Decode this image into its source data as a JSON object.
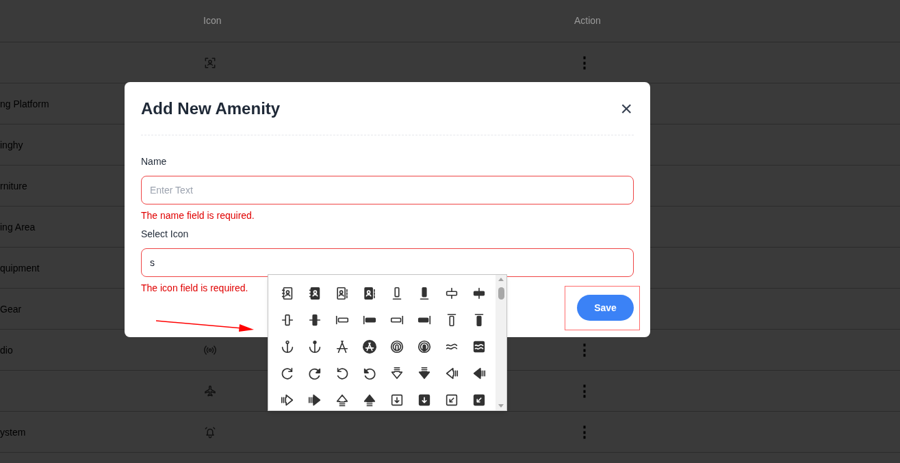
{
  "table": {
    "columns": [
      "Icon",
      "Action"
    ],
    "rows": [
      {
        "action": "⋮"
      },
      {
        "name": "ng Platform"
      },
      {
        "name": "inghy"
      },
      {
        "name": "rniture"
      },
      {
        "name": "ing Area"
      },
      {
        "name": "quipment"
      },
      {
        "name": "Gear"
      },
      {
        "name": "dio",
        "action": "⋮"
      },
      {
        "action": "⋮"
      },
      {
        "name": "ystem",
        "action": "⋮"
      }
    ]
  },
  "modal": {
    "title": "Add New Amenity",
    "close": "×",
    "fields": [
      {
        "label": "Name",
        "placeholder": "Enter Text",
        "error": "The name field is required."
      },
      {
        "label": "Select Icon",
        "value": "s",
        "error": "The icon field is required."
      }
    ],
    "icon_picker": {
      "open": true
    },
    "save_button": "Save"
  }
}
